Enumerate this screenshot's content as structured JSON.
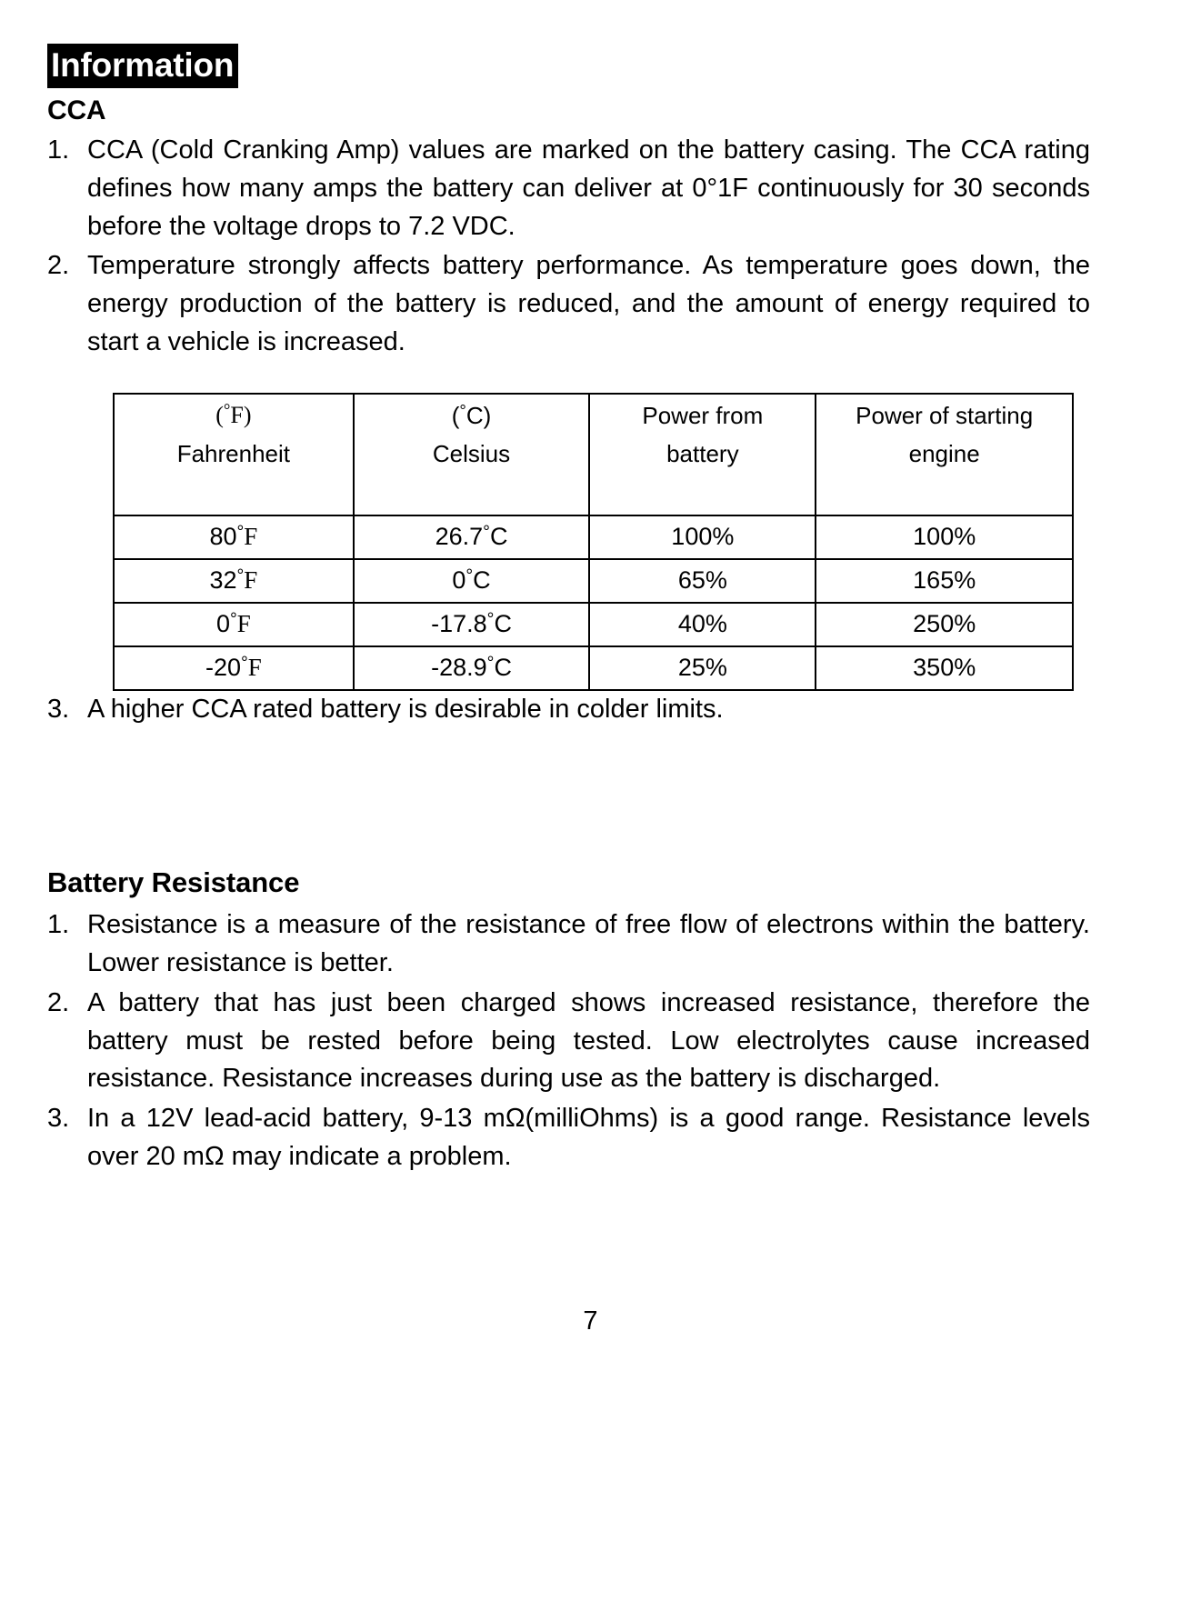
{
  "document": {
    "title": "Information",
    "page_number": "7"
  },
  "cca_section": {
    "heading": "CCA",
    "items": [
      {
        "number": "1.",
        "text": "CCA (Cold Cranking Amp) values are marked on the battery casing. The CCA rating defines how many amps the battery can deliver at 0°1F continuously for 30 seconds before the voltage drops to 7.2 VDC."
      },
      {
        "number": "2.",
        "text": "Temperature strongly affects battery performance. As temperature goes down, the energy production of the battery is reduced, and the amount of energy required to start a vehicle is increased."
      }
    ],
    "item3": {
      "number": "3.",
      "text": "A higher CCA rated battery is desirable in colder limits."
    }
  },
  "table": {
    "headers": [
      {
        "unit": "(°F)",
        "name": "Fahrenheit"
      },
      {
        "unit": "(°C)",
        "name": "Celsius"
      },
      {
        "unit": "Power from",
        "name": "battery"
      },
      {
        "unit": "Power of starting",
        "name": "engine"
      }
    ],
    "rows": [
      {
        "fahrenheit": "80°F",
        "celsius": "26.7°C",
        "power_battery": "100%",
        "power_engine": "100%"
      },
      {
        "fahrenheit": "32°F",
        "celsius": "0°C",
        "power_battery": "65%",
        "power_engine": "165%"
      },
      {
        "fahrenheit": "0°F",
        "celsius": "-17.8°C",
        "power_battery": "40%",
        "power_engine": "250%"
      },
      {
        "fahrenheit": "-20°F",
        "celsius": "-28.9°C",
        "power_battery": "25%",
        "power_engine": "350%"
      }
    ]
  },
  "resistance_section": {
    "heading": "Battery Resistance",
    "items": [
      {
        "number": "1.",
        "text": "Resistance is a measure of the resistance of free flow of electrons within the battery. Lower resistance is better."
      },
      {
        "number": "2.",
        "text": "A battery that has just been charged shows increased resistance, therefore the battery must be rested before being tested. Low electrolytes cause increased resistance. Resistance increases during use as the battery is discharged."
      },
      {
        "number": "3.",
        "text": "In a 12V lead-acid battery, 9-13 mΩ(milliOhms) is a good range. Resistance levels over 20 mΩ may indicate a problem."
      }
    ]
  }
}
